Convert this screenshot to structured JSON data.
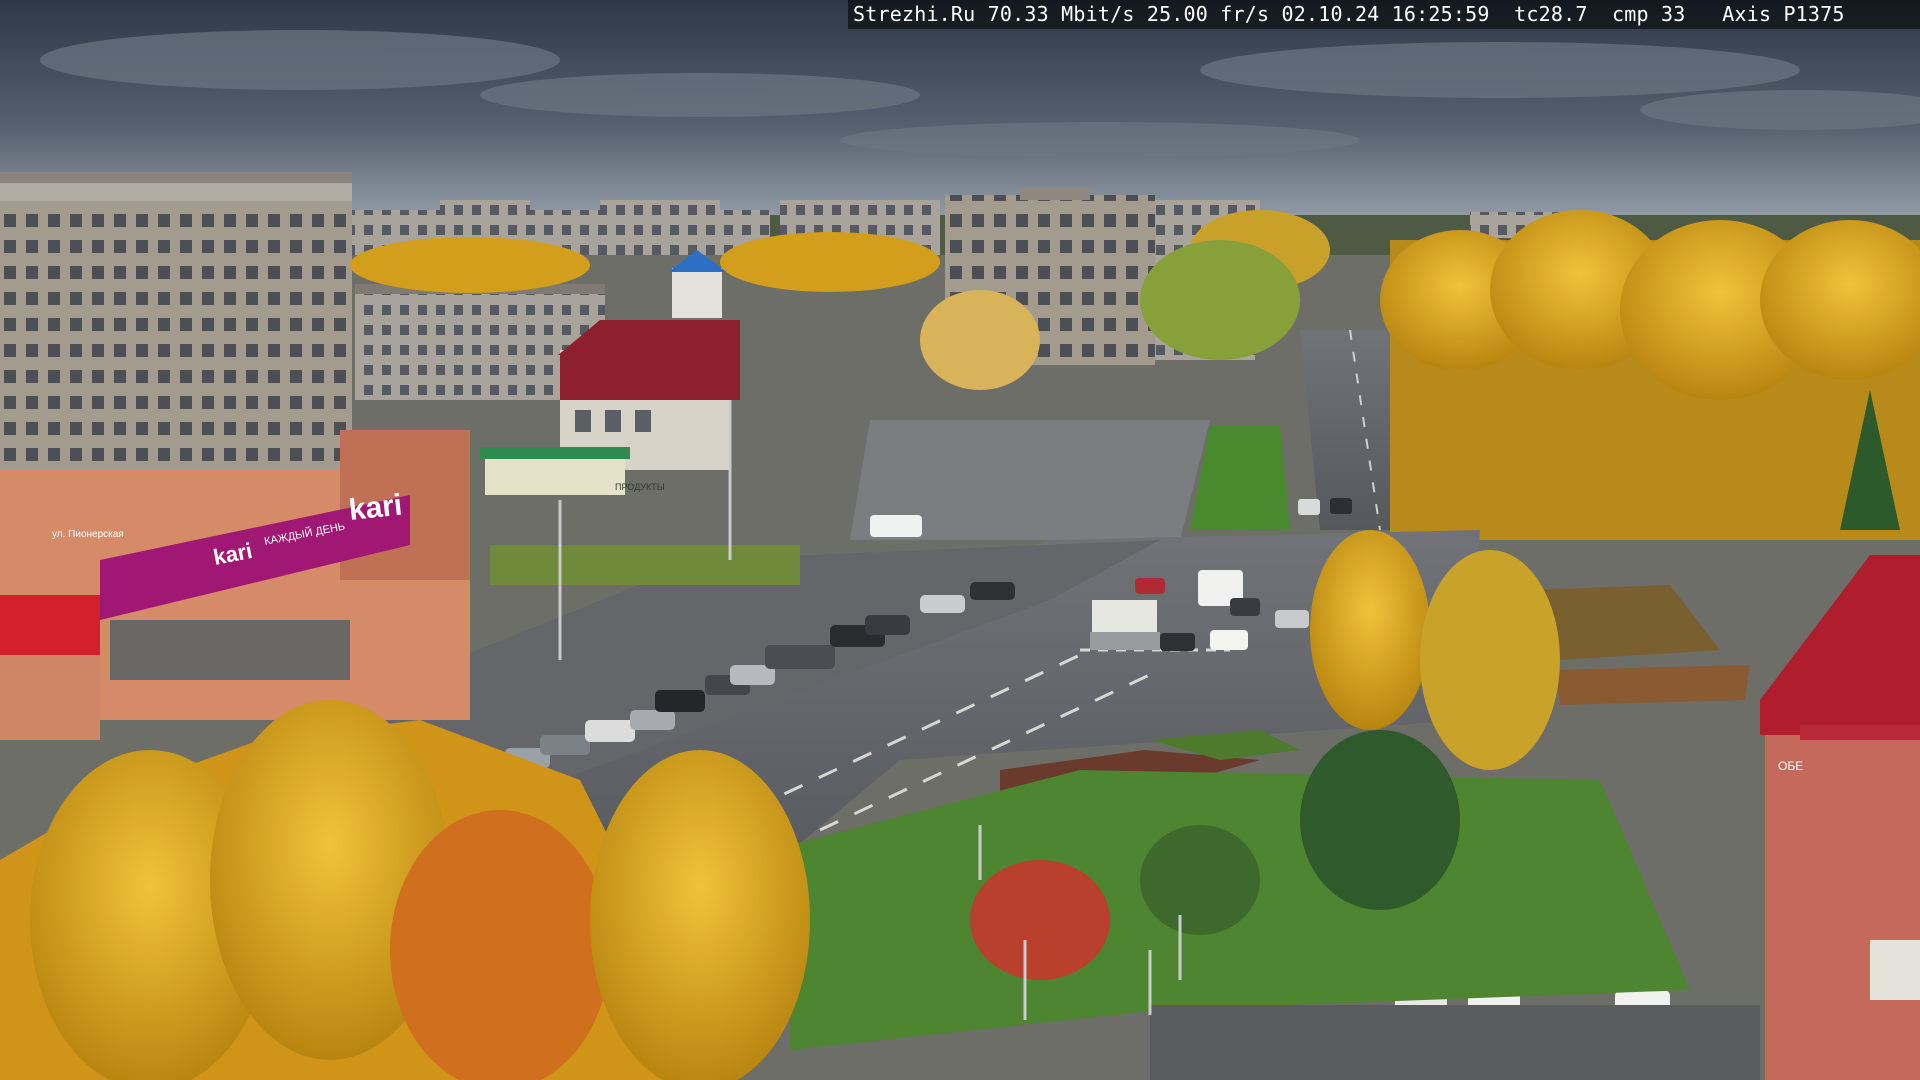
{
  "overlay": {
    "site": "Strezhi.Ru",
    "bitrate": "70.33 Mbit/s",
    "framerate": "25.00 fr/s",
    "date": "02.10.24",
    "time": "16:25:59",
    "temp": "tc28.7",
    "compression": "cmp 33",
    "camera": "Axis P1375"
  },
  "signs": {
    "store_main": "kari",
    "store_sub": "КАЖДЫЙ ДЕНЬ",
    "store_banner": "kari",
    "street_sign": "ул. Пионерская",
    "shop_sign": "ПРОДУКТЫ",
    "right_sign": "ОБЕ"
  },
  "colors": {
    "sky_top": "#2f3a4a",
    "sky_bottom": "#8b97a6",
    "foliage": "#d9a418",
    "asphalt": "#5e6064",
    "grass": "#4a8a2f",
    "kari_magenta": "#a01873",
    "building_red": "#b01e2e"
  }
}
